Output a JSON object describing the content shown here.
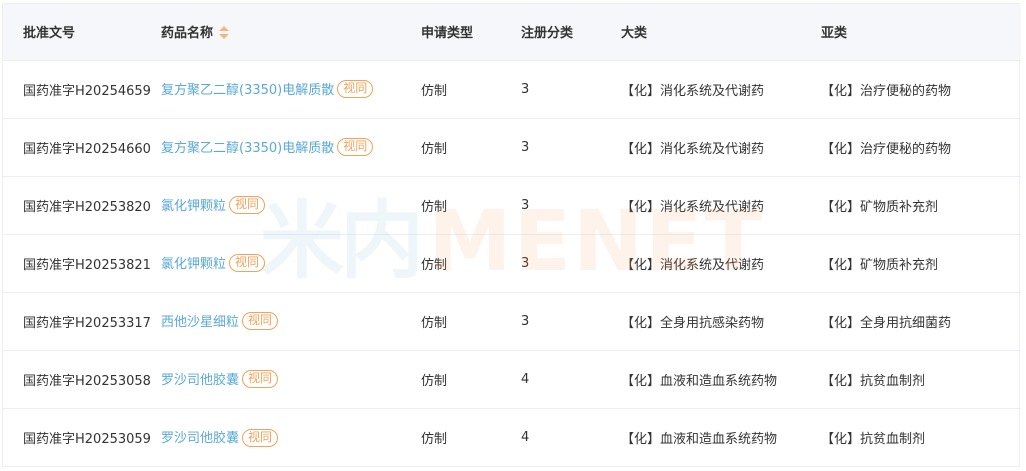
{
  "table": {
    "columns": [
      {
        "key": "approval_no",
        "label": "批准文号"
      },
      {
        "key": "drug_name",
        "label": "药品名称",
        "sortable": true
      },
      {
        "key": "app_type",
        "label": "申请类型"
      },
      {
        "key": "reg_class",
        "label": "注册分类"
      },
      {
        "key": "category",
        "label": "大类"
      },
      {
        "key": "subcategory",
        "label": "亚类"
      }
    ],
    "badge_label": "视同",
    "rows": [
      {
        "approval_no": "国药准字H20254659",
        "drug_name": "复方聚乙二醇(3350)电解质散",
        "app_type": "仿制",
        "reg_class": "3",
        "category": "【化】消化系统及代谢药",
        "subcategory": "【化】治疗便秘的药物"
      },
      {
        "approval_no": "国药准字H20254660",
        "drug_name": "复方聚乙二醇(3350)电解质散",
        "app_type": "仿制",
        "reg_class": "3",
        "category": "【化】消化系统及代谢药",
        "subcategory": "【化】治疗便秘的药物"
      },
      {
        "approval_no": "国药准字H20253820",
        "drug_name": "氯化钾颗粒",
        "app_type": "仿制",
        "reg_class": "3",
        "category": "【化】消化系统及代谢药",
        "subcategory": "【化】矿物质补充剂"
      },
      {
        "approval_no": "国药准字H20253821",
        "drug_name": "氯化钾颗粒",
        "app_type": "仿制",
        "reg_class": "3",
        "category": "【化】消化系统及代谢药",
        "subcategory": "【化】矿物质补充剂"
      },
      {
        "approval_no": "国药准字H20253317",
        "drug_name": "西他沙星细粒",
        "app_type": "仿制",
        "reg_class": "3",
        "category": "【化】全身用抗感染药物",
        "subcategory": "【化】全身用抗细菌药"
      },
      {
        "approval_no": "国药准字H20253058",
        "drug_name": "罗沙司他胶囊",
        "app_type": "仿制",
        "reg_class": "4",
        "category": "【化】血液和造血系统药物",
        "subcategory": "【化】抗贫血制剂"
      },
      {
        "approval_no": "国药准字H20253059",
        "drug_name": "罗沙司他胶囊",
        "app_type": "仿制",
        "reg_class": "4",
        "category": "【化】血液和造血系统药物",
        "subcategory": "【化】抗贫血制剂"
      }
    ]
  },
  "watermark": {
    "cn": "米内",
    "en": "MENET"
  },
  "colors": {
    "link": "#5aa9d6",
    "badge": "#f0a35a",
    "header_bg": "#f5f7fa",
    "border": "#ebeef5",
    "sort_icon": "#f5b87a"
  }
}
